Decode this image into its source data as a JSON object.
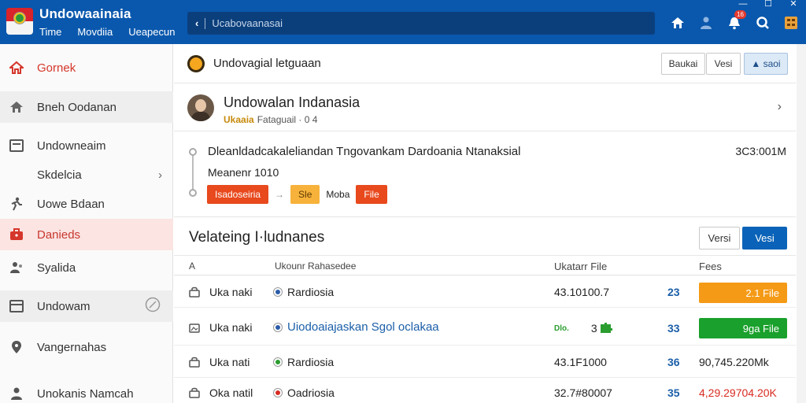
{
  "app": {
    "title": "Undowaainaia",
    "menu": [
      "Time",
      "Movdiia",
      "Ueapecun"
    ],
    "search_value": "Ucabovaanasai",
    "window_controls": [
      "—",
      "☐",
      "✕"
    ],
    "notification_badge": "16",
    "icons": [
      "home-icon",
      "person-icon",
      "notification-icon",
      "search-icon",
      "apps-icon"
    ],
    "colors": {
      "titlebar": "#0a58ad",
      "accent": "#0a63b8",
      "active_sidebar": "#fbe4e2",
      "danger": "#e8491d"
    }
  },
  "sidebar": {
    "items": [
      {
        "label": "Gornek",
        "icon": "home-icon"
      },
      {
        "label": "Bneh Oodanan",
        "icon": "home-icon"
      },
      {
        "label": "Undowneaim",
        "icon": "list-icon"
      },
      {
        "label": "Skdelcia",
        "icon": ""
      },
      {
        "label": "Uowe Bdaan",
        "icon": "run-icon"
      },
      {
        "label": "Danieds",
        "icon": "briefcase-icon"
      },
      {
        "label": "Syalida",
        "icon": "users-icon"
      },
      {
        "label": "Undowam",
        "icon": "window-icon"
      },
      {
        "label": "Vangernahas",
        "icon": "location-icon"
      },
      {
        "label": "Unokanis Namcah",
        "icon": "person-icon"
      }
    ]
  },
  "header_row": {
    "label": "Undovagial letguaan",
    "buttons": [
      "Baukai",
      "Vesi",
      "▲ saoi"
    ]
  },
  "profile": {
    "name": "Undowalan Indanasia",
    "tag": "Ukaaia",
    "meta": "Fataguail · 0 4"
  },
  "activity": {
    "line1": "Dleanldadcakaleliandan Tngovankam Dardoania Ntanaksial",
    "time": "3C3:001M",
    "line2": "Meanenr 1010",
    "chips": [
      "Isadoseiria",
      "Sle",
      "Moba",
      "File"
    ]
  },
  "section": {
    "title": "Velateing I·ludnanes",
    "buttons": [
      "Versi",
      "Vesi"
    ]
  },
  "table": {
    "headers": [
      "A",
      "Ukounr Rahasedee",
      "Ukatarr File",
      "Fees"
    ],
    "rows": [
      {
        "name": "Uka naki",
        "desc": "Rardiosia",
        "dot": "#2a5ca8",
        "size": "43.10100.7",
        "num": "23",
        "fees": "2.1 File",
        "fee_style": "orange"
      },
      {
        "name": "Uka naki",
        "desc": "Uiodoaiajaskan Sgol oclakaa",
        "dot": "#2a5ca8",
        "size": "3",
        "size_prefix": "Dlo.",
        "num": "33",
        "fees": "9ga File",
        "fee_style": "green"
      },
      {
        "name": "Uka nati",
        "desc": "Rardiosia",
        "dot": "#2a9d2f",
        "size": "43.1F1000",
        "num": "36",
        "fees": "90,745.220Mk",
        "fee_style": "text"
      },
      {
        "name": "Oka natil",
        "desc": "Oadriosia",
        "dot": "#d72b22",
        "size": "32.7#80007",
        "num": "35",
        "fees": "4,29.29704.20K",
        "fee_style": "red"
      }
    ]
  }
}
